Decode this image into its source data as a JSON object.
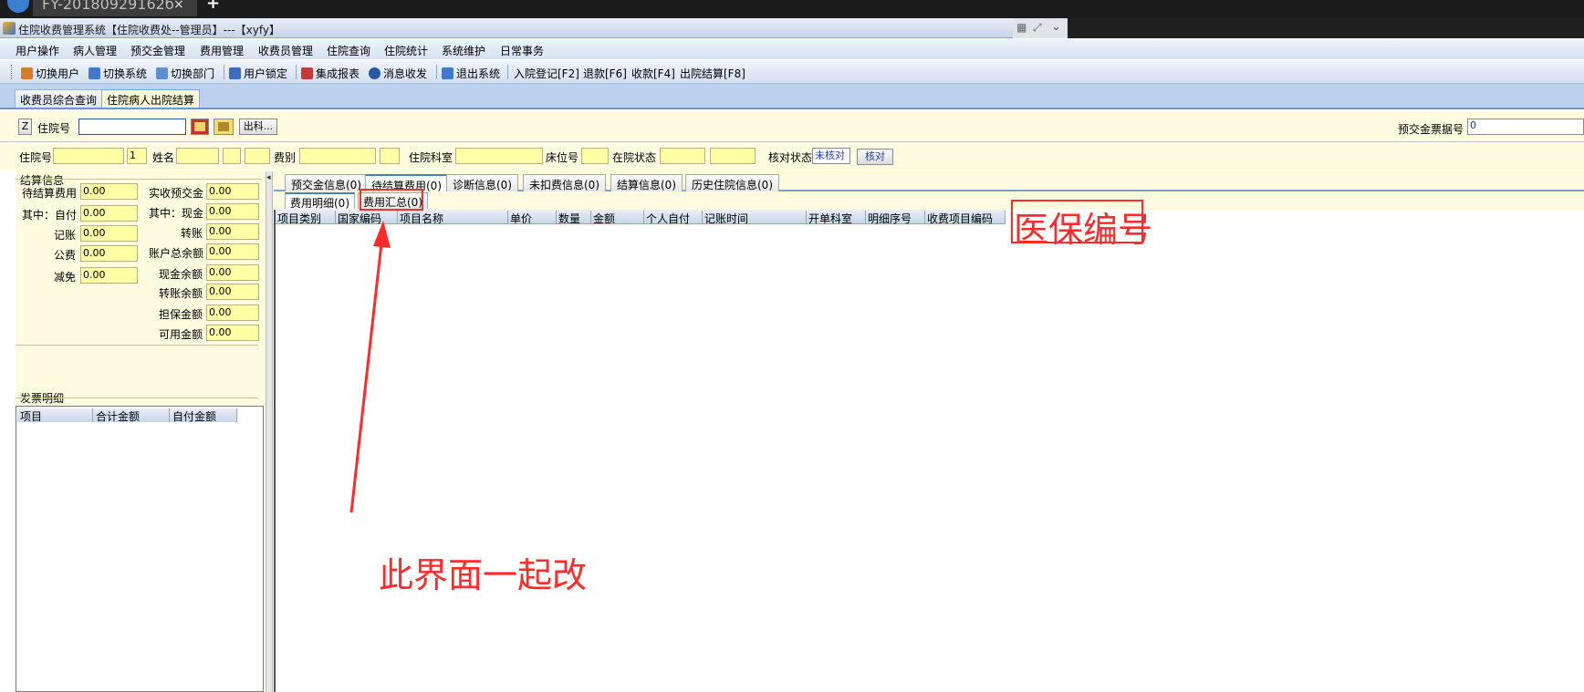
{
  "browser_tab": {
    "title": "FY-20180929162б",
    "close": "×",
    "add": "+"
  },
  "window": {
    "title": "住院收费管理系统【住院收费处--管理员】---【xyfy】"
  },
  "menu": [
    "用户操作",
    "病人管理",
    "预交金管理",
    "费用管理",
    "收费员管理",
    "住院查询",
    "住院统计",
    "系统维护",
    "日常事务"
  ],
  "toolbar": [
    {
      "label": "切换用户",
      "icon": "users-icon",
      "color": "#d97a2a"
    },
    {
      "label": "切换系统",
      "icon": "switch-system-icon",
      "color": "#3d7ad0"
    },
    {
      "label": "切换部门",
      "icon": "department-icon",
      "color": "#5a8fd8"
    },
    {
      "label": "用户锁定",
      "icon": "user-lock-icon",
      "color": "#3a6cc4"
    },
    {
      "label": "集成报表",
      "icon": "report-icon",
      "color": "#c43a3a"
    },
    {
      "label": "消息收发",
      "icon": "message-icon",
      "color": "#2b56a8"
    },
    {
      "label": "退出系统",
      "icon": "exit-icon",
      "color": "#3d7ad0"
    },
    {
      "label": "入院登记[F2]"
    },
    {
      "label": "退款[F6]"
    },
    {
      "label": "收款[F4]"
    },
    {
      "label": "出院结算[F8]"
    }
  ],
  "doc_tabs": [
    "收费员综合查询",
    "住院病人出院结算"
  ],
  "search": {
    "key_label": "Z",
    "label": "住院号",
    "value": "",
    "discharge_button": "出科...",
    "deposit_receipt_label": "预交金票据号",
    "deposit_receipt_value": "0"
  },
  "patient": {
    "inpatient_no_label": "住院号",
    "inpatient_no_value": "",
    "times_value": "1",
    "name_label": "姓名",
    "fee_type_label": "费别",
    "dept_label": "住院科室",
    "bed_label": "床位号",
    "status_label": "在院状态",
    "check_status_label": "核对状态",
    "check_status_value": "未核对",
    "check_button": "核对"
  },
  "settlement": {
    "title": "结算信息",
    "left_fields": [
      {
        "label": "待结算费用",
        "value": "0.00"
      },
      {
        "label": "其中：自付",
        "value": "0.00"
      },
      {
        "label": "记账",
        "value": "0.00"
      },
      {
        "label": "公费",
        "value": "0.00"
      },
      {
        "label": "减免",
        "value": "0.00"
      }
    ],
    "right_fields": [
      {
        "label": "实收预交金",
        "value": "0.00"
      },
      {
        "label": "其中：现金",
        "value": "0.00"
      },
      {
        "label": "转账",
        "value": "0.00"
      },
      {
        "label": "账户总余额",
        "value": "0.00"
      },
      {
        "label": "现金余额",
        "value": "0.00"
      },
      {
        "label": "转账余额",
        "value": "0.00"
      },
      {
        "label": "担保金额",
        "value": "0.00"
      },
      {
        "label": "可用金额",
        "value": "0.00"
      }
    ]
  },
  "invoice": {
    "title": "发票明细",
    "columns": [
      "项目",
      "合计金额",
      "自付金额"
    ]
  },
  "right_tabs": [
    "预交金信息(0)",
    "待结算费用(0)",
    "诊断信息(0)",
    "未扣费信息(0)",
    "结算信息(0)",
    "历史住院信息(0)"
  ],
  "sub_tabs": [
    "费用明细(0)",
    "费用汇总(0)"
  ],
  "grid_columns": [
    "项目类别",
    "国家编码",
    "项目名称",
    "单价",
    "数量",
    "金额",
    "个人自付",
    "记账时间",
    "开单科室",
    "明细序号",
    "收费项目编码"
  ],
  "annotations": {
    "medical_insurance_no": "医保编号",
    "change_together": "此界面一起改"
  },
  "colors": {
    "field_yellow": "#ffffa6",
    "panel_bg": "#fffbe0",
    "annotation_red": "#ff2a2a",
    "tab_blue": "#bcd1ee"
  }
}
